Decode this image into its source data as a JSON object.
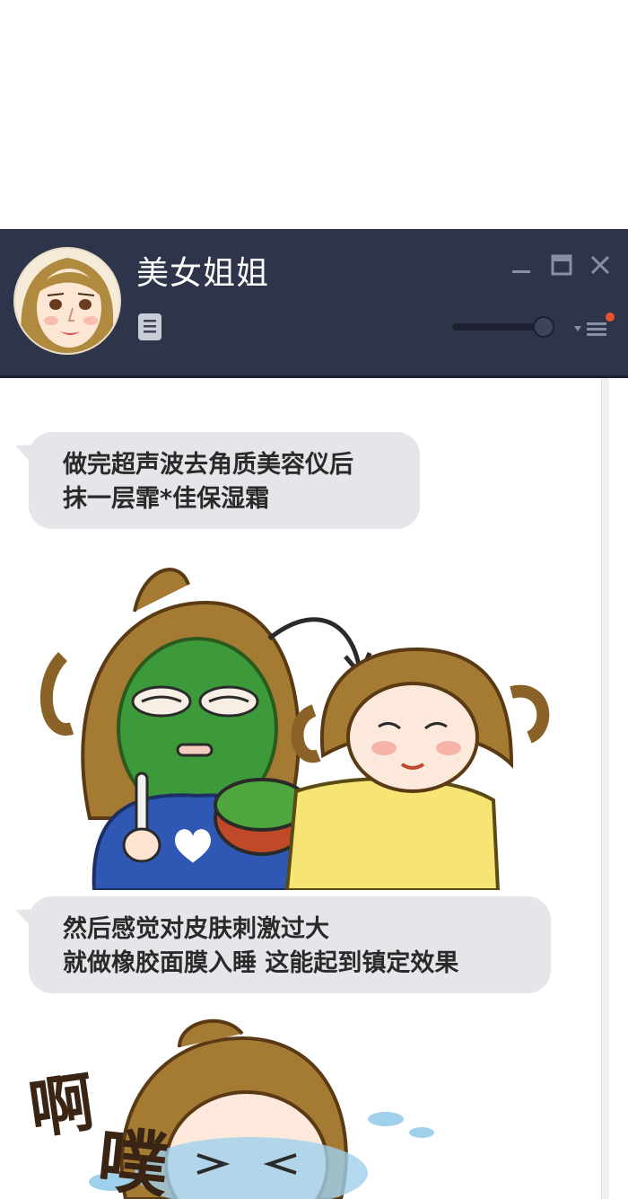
{
  "window": {
    "contact_name": "美女姐姐",
    "controls": [
      "minimize-icon",
      "maximize-icon",
      "close-icon"
    ],
    "accent_color": "#e8542f",
    "header_color": "#2e3449"
  },
  "messages": [
    {
      "lines": [
        "做完超声波去角质美容仪后",
        "抹一层霏*佳保湿霜"
      ]
    },
    {
      "lines": [
        "然后感觉对皮肤刺激过大",
        "就做橡胶面膜入睡 这能起到镇定效果"
      ]
    }
  ],
  "comic2_text": [
    "啊",
    "噗"
  ]
}
